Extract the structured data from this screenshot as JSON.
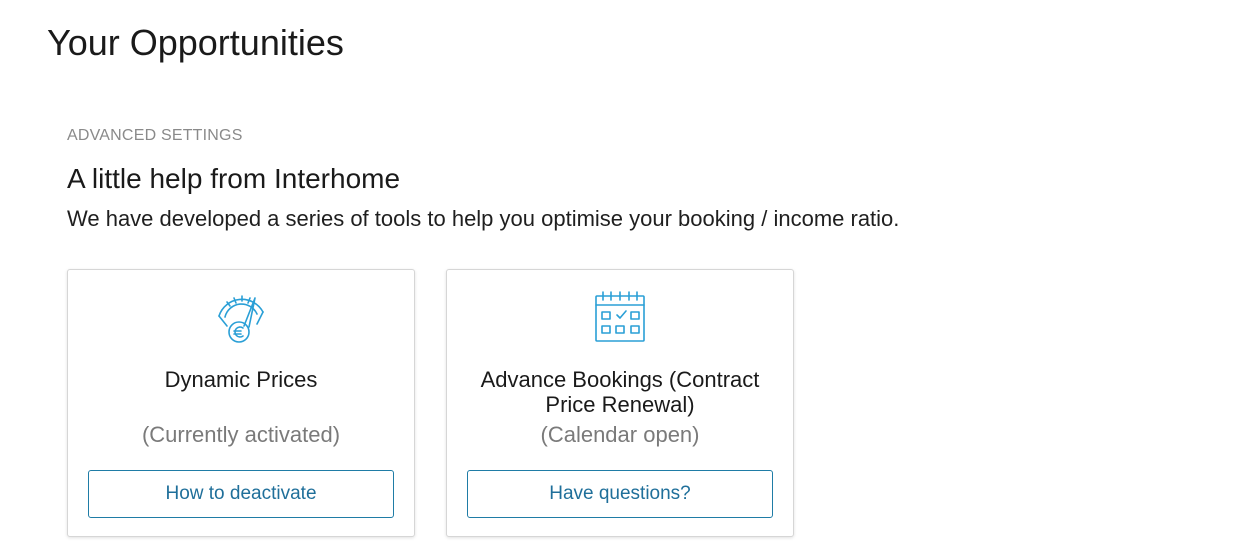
{
  "page": {
    "title": "Your Opportunities"
  },
  "section": {
    "eyebrow": "ADVANCED SETTINGS",
    "title": "A little help from Interhome",
    "description": "We have developed a series of tools to help you optimise your booking / income ratio."
  },
  "cards": [
    {
      "icon": "speedometer-euro-icon",
      "title": "Dynamic Prices",
      "status": "(Currently activated)",
      "button_label": "How to deactivate"
    },
    {
      "icon": "calendar-check-icon",
      "title": "Advance Bookings (Contract Price Renewal)",
      "status": "(Calendar open)",
      "button_label": "Have questions?"
    }
  ],
  "colors": {
    "accent": "#1f7ca6",
    "icon": "#2a9fd6",
    "muted_text": "#8a8a8a"
  }
}
